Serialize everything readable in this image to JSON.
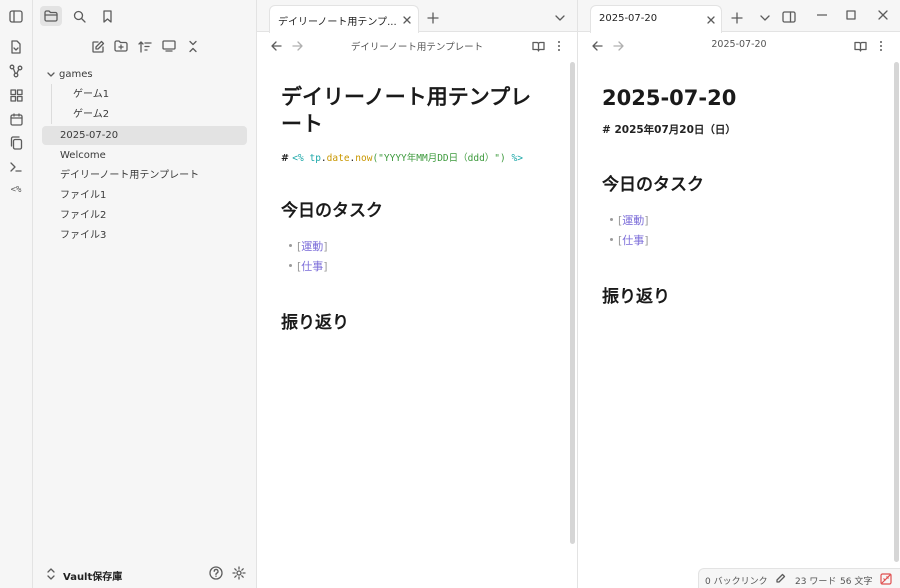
{
  "sidebar": {
    "tree": {
      "folder": "games",
      "children": [
        "ゲーム1",
        "ゲーム2"
      ],
      "items": [
        "2025-07-20",
        "Welcome",
        "デイリーノート用テンプレート",
        "ファイル1",
        "ファイル2",
        "ファイル3"
      ]
    },
    "vault_name": "Vault保存庫"
  },
  "ribbon": {
    "templater_label": "<%"
  },
  "pane1": {
    "tab_title": "デイリーノート用テンプ...",
    "view_title": "デイリーノート用テンプレート",
    "h1_line1": "デイリーノート用テンプレ",
    "h1_line2": "ート",
    "code": {
      "hash": "# ",
      "open": "<%",
      "obj": "tp",
      "dot1": ".",
      "prop": "date",
      "dot2": ".",
      "fn": "now",
      "args": "(\"YYYY年MM月DD日（ddd）\")",
      "close": "%>"
    },
    "h2_tasks": "今日のタスク",
    "tasks": [
      "運動",
      "仕事"
    ],
    "h2_review": "振り返り"
  },
  "pane2": {
    "tab_title": "2025-07-20",
    "view_title": "2025-07-20",
    "h1": "2025-07-20",
    "date_line": "# 2025年07月20日（日）",
    "h2_tasks": "今日のタスク",
    "tasks": [
      "運動",
      "仕事"
    ],
    "h2_review": "振り返り"
  },
  "status": {
    "backlinks": "0 バックリンク",
    "words": "23 ワード",
    "chars": "56 文字"
  },
  "colors": {
    "accent_link": "#7b6cd9",
    "code_keyword": "#1ba7a8",
    "code_string": "#3d9a3d",
    "code_func": "#c99700",
    "sync_icon": "#e05050"
  }
}
